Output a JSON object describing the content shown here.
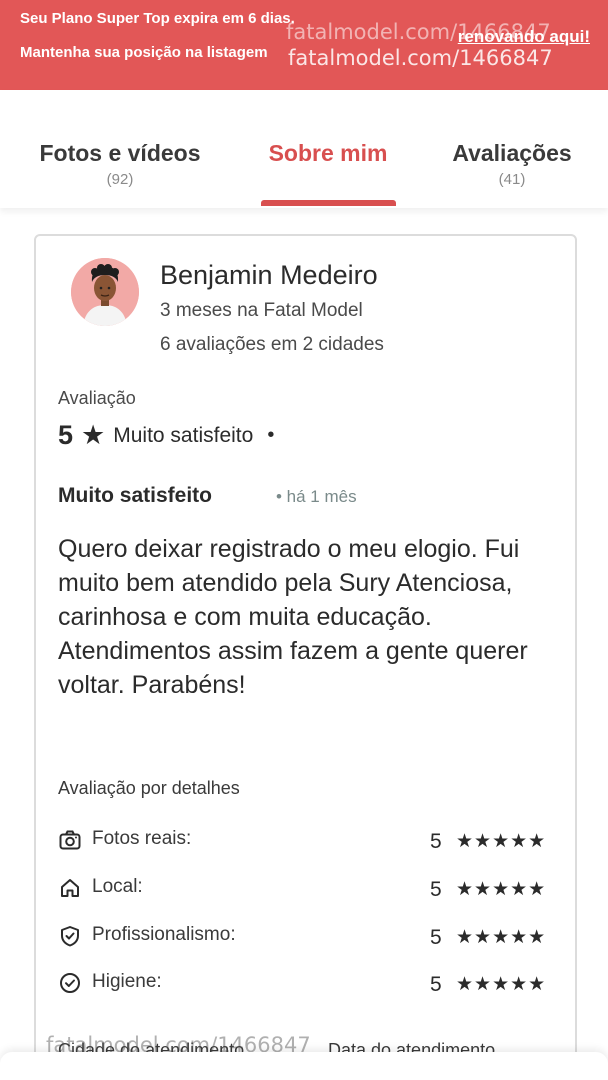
{
  "banner": {
    "line1": "Seu Plano Super Top expira em 6 dias.",
    "line2": "Mantenha sua posição na listagem",
    "link": "renovando aqui!",
    "watermark": "fatalmodel.com/1466847"
  },
  "tabs": [
    {
      "label": "Fotos e vídeos",
      "count": "(92)",
      "active": false
    },
    {
      "label": "Sobre mim",
      "count": "",
      "active": true
    },
    {
      "label": "Avaliações",
      "count": "(41)",
      "active": false
    }
  ],
  "review": {
    "reviewer": {
      "name": "Benjamin Medeiro",
      "tenure": "3 meses na Fatal Model",
      "reviews_count": "6 avaliações em 2 cidades"
    },
    "rating_label": "Avaliação",
    "rating_value": "5",
    "rating_text": "Muito satisfeito",
    "title": "Muito satisfeito",
    "time": "• há 1 mês",
    "body": "Quero deixar registrado o meu elogio. Fui muito bem atendido pela Sury Atenciosa, carinhosa e com muita educação. Atendimentos assim fazem a gente querer voltar. Parabéns!",
    "details_title": "Avaliação por detalhes",
    "details": [
      {
        "icon": "camera-icon",
        "label": "Fotos reais:",
        "score": "5",
        "stars": 5
      },
      {
        "icon": "home-icon",
        "label": "Local:",
        "score": "5",
        "stars": 5
      },
      {
        "icon": "shield-check-icon",
        "label": "Profissionalismo:",
        "score": "5",
        "stars": 5
      },
      {
        "icon": "check-circle-icon",
        "label": "Higiene:",
        "score": "5",
        "stars": 5
      }
    ],
    "city_header": "Cidade do atendimento",
    "date_header": "Data do atendimento"
  },
  "colors": {
    "banner_bg": "#e25757",
    "accent": "#d84f4f",
    "avatar_bg": "#f2a9a6"
  }
}
